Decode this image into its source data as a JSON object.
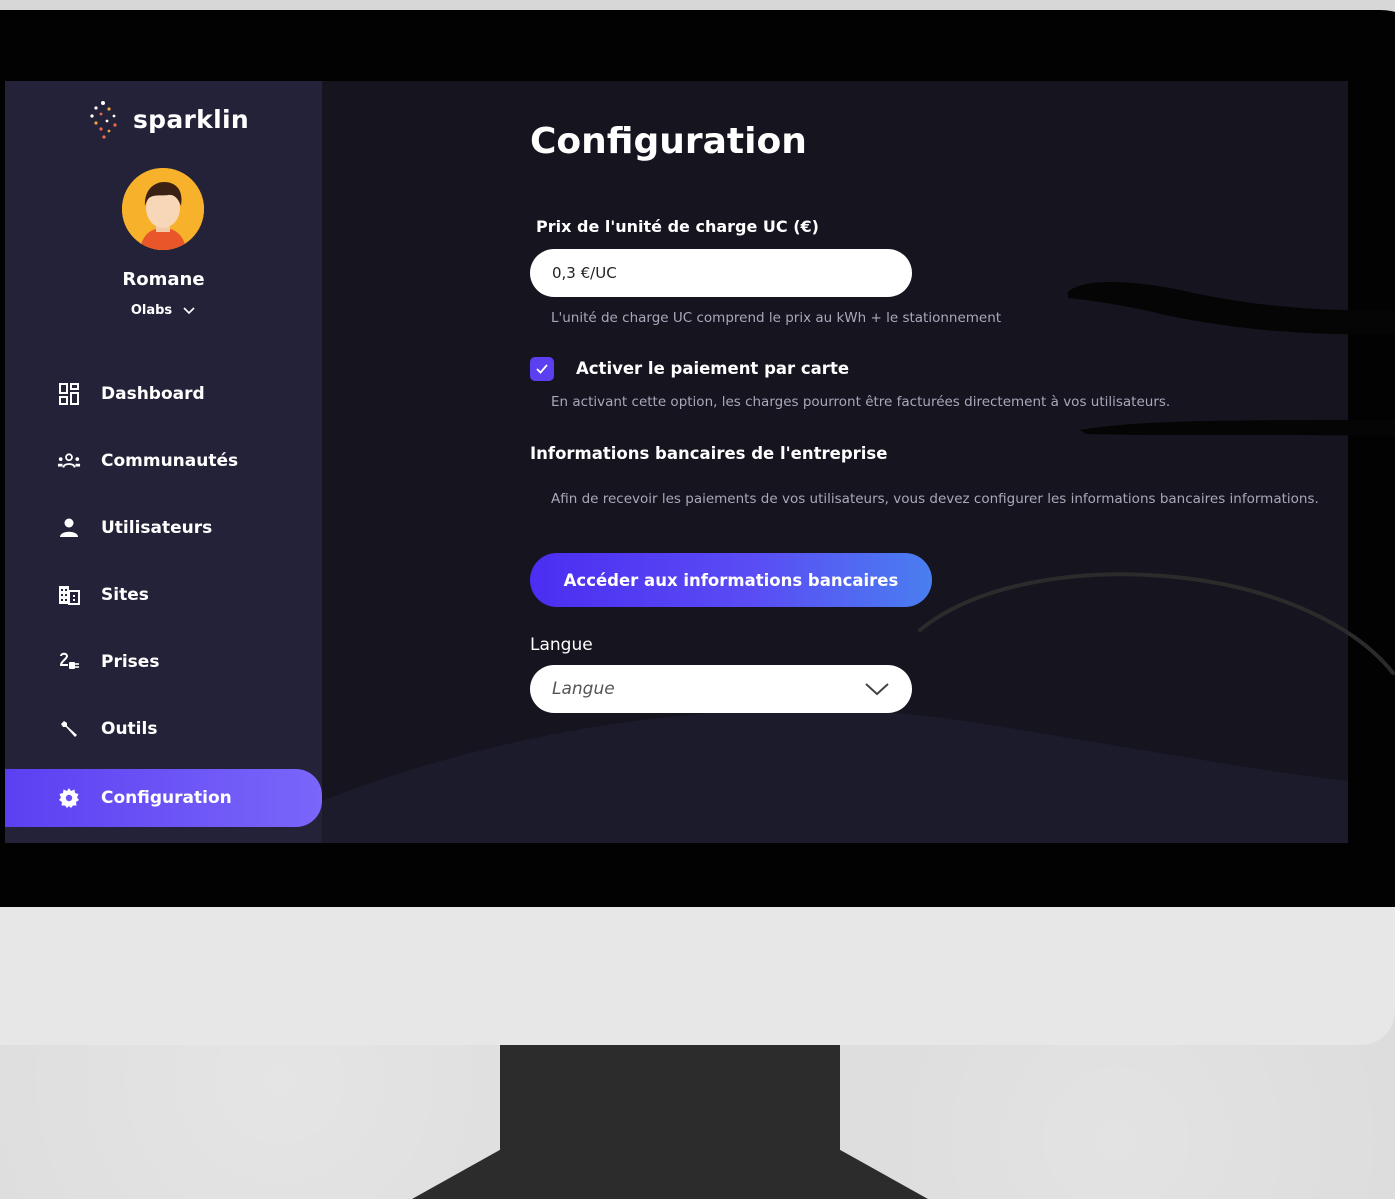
{
  "app": {
    "brand": "sparklin"
  },
  "user": {
    "name": "Romane",
    "organization": "Olabs"
  },
  "sidebar": {
    "items": [
      {
        "label": "Dashboard",
        "icon": "dashboard-icon",
        "active": false
      },
      {
        "label": "Communautés",
        "icon": "communities-icon",
        "active": false
      },
      {
        "label": "Utilisateurs",
        "icon": "user-icon",
        "active": false
      },
      {
        "label": "Sites",
        "icon": "building-icon",
        "active": false
      },
      {
        "label": "Prises",
        "icon": "plug-icon",
        "active": false
      },
      {
        "label": "Outils",
        "icon": "wrench-icon",
        "active": false
      },
      {
        "label": "Configuration",
        "icon": "gear-icon",
        "active": true
      }
    ]
  },
  "main": {
    "title": "Configuration",
    "price": {
      "label": "Prix de l'unité de charge UC (€)",
      "value": "0,3 €/UC",
      "help": "L'unité de charge UC comprend le prix au kWh + le stationnement"
    },
    "card_payment": {
      "label": "Activer le paiement par carte",
      "checked": true,
      "help": "En activant cette option, les charges pourront être facturées directement à vos utilisateurs."
    },
    "bank": {
      "title": "Informations bancaires de l'entreprise",
      "description": "Afin de recevoir les paiements de vos utilisateurs, vous devez configurer les informations bancaires informations.",
      "button_label": "Accéder aux informations bancaires"
    },
    "language": {
      "label": "Langue",
      "placeholder": "Langue"
    }
  },
  "colors": {
    "accent": "#5b40f2",
    "sidebar_bg": "#242238",
    "content_bg": "#15141f"
  }
}
